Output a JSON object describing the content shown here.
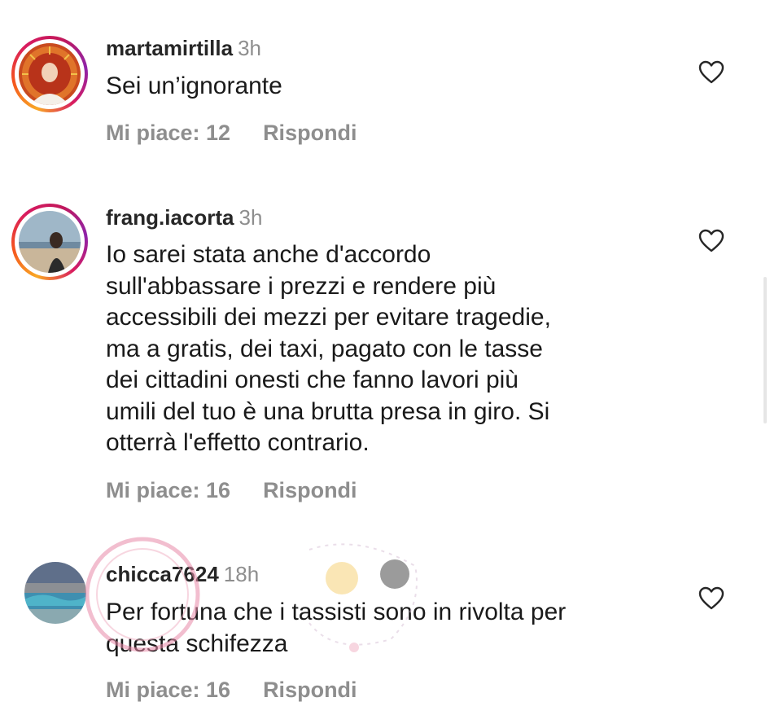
{
  "comments": [
    {
      "username": "martamirtilla",
      "time": "3h",
      "lines": [
        "Sei un’ignorante"
      ],
      "likes_label": "Mi piace: 12",
      "reply_label": "Rispondi",
      "avatar_story_ring": true
    },
    {
      "username": "frang.iacorta",
      "time": "3h",
      "lines": [
        "Io sarei stata anche d'accordo",
        "sull'abbassare i prezzi e rendere più",
        "accessibili dei mezzi per evitare tragedie,",
        "ma a gratis, dei taxi, pagato con le tasse",
        "dei cittadini onesti che fanno lavori più",
        "umili del tuo è una brutta presa in giro. Si",
        "otterrà l'effetto contrario."
      ],
      "likes_label": "Mi piace: 16",
      "reply_label": "Rispondi",
      "avatar_story_ring": true
    },
    {
      "username": "chicca7624",
      "time": "18h",
      "lines": [
        "Per fortuna che i tassisti sono in rivolta per",
        "questa schifezza"
      ],
      "likes_label": "Mi piace: 16",
      "reply_label": "Rispondi",
      "avatar_story_ring": false
    }
  ],
  "icons": {
    "like": "heart-outline-icon"
  },
  "colors": {
    "username": "#262626",
    "meta": "#8e8e8e",
    "text": "#1a1a1a"
  }
}
